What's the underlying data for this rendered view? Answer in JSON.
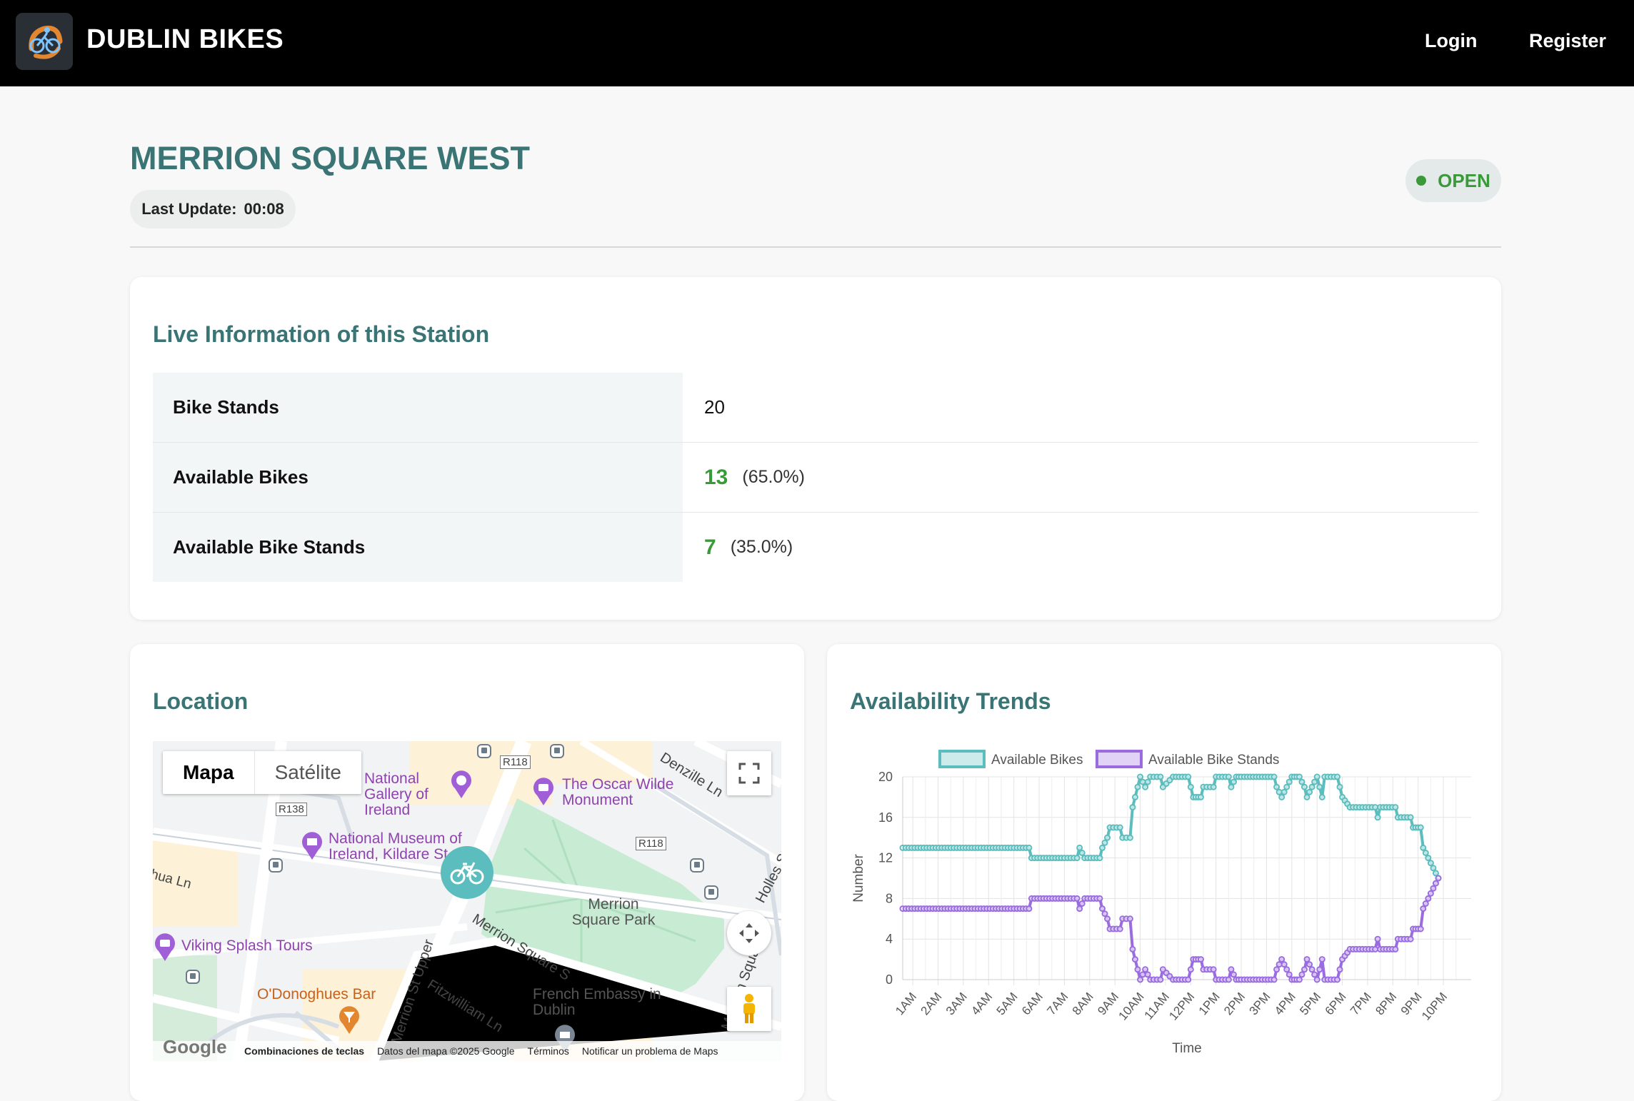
{
  "nav": {
    "brand": "DUBLIN BIKES",
    "login": "Login",
    "register": "Register"
  },
  "station": {
    "name": "MERRION SQUARE WEST",
    "last_update_label": "Last Update:",
    "last_update_value": "00:08",
    "status": "OPEN"
  },
  "live": {
    "title": "Live Information of this Station",
    "rows": [
      {
        "label": "Bike Stands",
        "value": "20"
      },
      {
        "label": "Available Bikes",
        "value": "13",
        "pct": "(65.0%)"
      },
      {
        "label": "Available Bike Stands",
        "value": "7",
        "pct": "(35.0%)"
      }
    ]
  },
  "location": {
    "title": "Location",
    "map_type": {
      "map": "Mapa",
      "satellite": "Satélite"
    },
    "places": {
      "gallery": "National Gallery of Ireland",
      "museum": "National Museum of Ireland, Kildare St",
      "oscar": "The Oscar Wilde Monument",
      "park": "Merrion Square Park",
      "viking": "Viking Splash Tours",
      "bar": "O'Donoghues Bar",
      "embassy": "French Embassy in Dublin"
    },
    "streets": {
      "s1": "Merrion Square S",
      "s2": "Merrion St Upper",
      "s3": "Fitzwilliam Ln",
      "s4": "Denzille Ln",
      "s5": "Holles St",
      "s6": "hua Ln",
      "r1": "R118",
      "r2": "R138",
      "r3": "R118",
      "s7": "Merrion Squa..."
    },
    "footer": {
      "logo": "Google",
      "shortcuts": "Combinaciones de teclas",
      "data": "Datos del mapa ©2025 Google",
      "terms": "Términos",
      "report": "Notificar un problema de Maps"
    }
  },
  "trends": {
    "title": "Availability Trends"
  },
  "chart_data": {
    "type": "line",
    "xlabel": "Time",
    "ylabel": "Number",
    "ylim": [
      0,
      20
    ],
    "yticks": [
      0,
      4,
      8,
      12,
      16,
      20
    ],
    "xticks": [
      "1AM",
      "2AM",
      "3AM",
      "4AM",
      "5AM",
      "6AM",
      "7AM",
      "8AM",
      "9AM",
      "10AM",
      "11AM",
      "12PM",
      "1PM",
      "2PM",
      "3PM",
      "4PM",
      "5PM",
      "6PM",
      "7PM",
      "8PM",
      "9PM",
      "10PM"
    ],
    "xrange": [
      0.6,
      23.1
    ],
    "legend": "top",
    "grid": true,
    "series": [
      {
        "name": "Available Bikes",
        "color": "#5bbdbd",
        "points": [
          [
            0.6,
            13
          ],
          [
            5.6,
            13
          ],
          [
            5.7,
            12
          ],
          [
            7.0,
            12
          ],
          [
            7.5,
            12
          ],
          [
            7.6,
            13
          ],
          [
            7.8,
            12
          ],
          [
            8.4,
            12
          ],
          [
            8.5,
            13
          ],
          [
            8.7,
            14
          ],
          [
            8.8,
            15
          ],
          [
            9.2,
            15
          ],
          [
            9.3,
            14
          ],
          [
            9.6,
            14
          ],
          [
            9.7,
            17
          ],
          [
            9.8,
            18
          ],
          [
            9.9,
            19
          ],
          [
            10.0,
            20
          ],
          [
            10.2,
            19
          ],
          [
            10.4,
            20
          ],
          [
            10.8,
            20
          ],
          [
            10.9,
            19
          ],
          [
            11.3,
            20
          ],
          [
            11.9,
            20
          ],
          [
            12.0,
            19
          ],
          [
            12.1,
            18
          ],
          [
            12.4,
            18
          ],
          [
            12.5,
            19
          ],
          [
            12.9,
            19
          ],
          [
            13.0,
            20
          ],
          [
            13.5,
            20
          ],
          [
            13.6,
            19
          ],
          [
            13.8,
            20
          ],
          [
            14.0,
            20
          ],
          [
            15.3,
            20
          ],
          [
            15.4,
            19
          ],
          [
            15.6,
            18
          ],
          [
            15.8,
            19
          ],
          [
            16.0,
            20
          ],
          [
            16.3,
            20
          ],
          [
            16.5,
            19
          ],
          [
            16.6,
            18
          ],
          [
            16.8,
            19
          ],
          [
            17.0,
            20
          ],
          [
            17.2,
            18
          ],
          [
            17.3,
            20
          ],
          [
            17.8,
            20
          ],
          [
            18.0,
            18
          ],
          [
            18.3,
            17
          ],
          [
            19.3,
            17
          ],
          [
            19.4,
            16
          ],
          [
            19.5,
            17
          ],
          [
            20.1,
            17
          ],
          [
            20.2,
            16
          ],
          [
            20.7,
            16
          ],
          [
            20.8,
            15
          ],
          [
            21.1,
            15
          ],
          [
            21.2,
            13
          ],
          [
            21.4,
            12
          ],
          [
            21.6,
            11
          ],
          [
            21.8,
            10
          ]
        ]
      },
      {
        "name": "Available Bike Stands",
        "color": "#9a6cdf",
        "points": [
          [
            0.6,
            7
          ],
          [
            5.6,
            7
          ],
          [
            5.7,
            8
          ],
          [
            7.0,
            8
          ],
          [
            7.5,
            8
          ],
          [
            7.6,
            7
          ],
          [
            7.8,
            8
          ],
          [
            8.4,
            8
          ],
          [
            8.5,
            7
          ],
          [
            8.7,
            6
          ],
          [
            8.8,
            5
          ],
          [
            9.2,
            5
          ],
          [
            9.3,
            6
          ],
          [
            9.6,
            6
          ],
          [
            9.7,
            3
          ],
          [
            9.8,
            2
          ],
          [
            9.9,
            1
          ],
          [
            10.0,
            0
          ],
          [
            10.2,
            1
          ],
          [
            10.4,
            0
          ],
          [
            10.8,
            0
          ],
          [
            10.9,
            1
          ],
          [
            11.3,
            0
          ],
          [
            11.9,
            0
          ],
          [
            12.0,
            1
          ],
          [
            12.1,
            2
          ],
          [
            12.4,
            2
          ],
          [
            12.5,
            1
          ],
          [
            12.9,
            1
          ],
          [
            13.0,
            0
          ],
          [
            13.5,
            0
          ],
          [
            13.6,
            1
          ],
          [
            13.8,
            0
          ],
          [
            14.0,
            0
          ],
          [
            15.3,
            0
          ],
          [
            15.4,
            1
          ],
          [
            15.6,
            2
          ],
          [
            15.8,
            1
          ],
          [
            16.0,
            0
          ],
          [
            16.3,
            0
          ],
          [
            16.5,
            1
          ],
          [
            16.6,
            2
          ],
          [
            16.8,
            1
          ],
          [
            17.0,
            0
          ],
          [
            17.2,
            2
          ],
          [
            17.3,
            0
          ],
          [
            17.8,
            0
          ],
          [
            18.0,
            2
          ],
          [
            18.3,
            3
          ],
          [
            19.3,
            3
          ],
          [
            19.4,
            4
          ],
          [
            19.5,
            3
          ],
          [
            20.1,
            3
          ],
          [
            20.2,
            4
          ],
          [
            20.7,
            4
          ],
          [
            20.8,
            5
          ],
          [
            21.1,
            5
          ],
          [
            21.2,
            7
          ],
          [
            21.4,
            8
          ],
          [
            21.6,
            9
          ],
          [
            21.8,
            10
          ]
        ]
      }
    ]
  }
}
